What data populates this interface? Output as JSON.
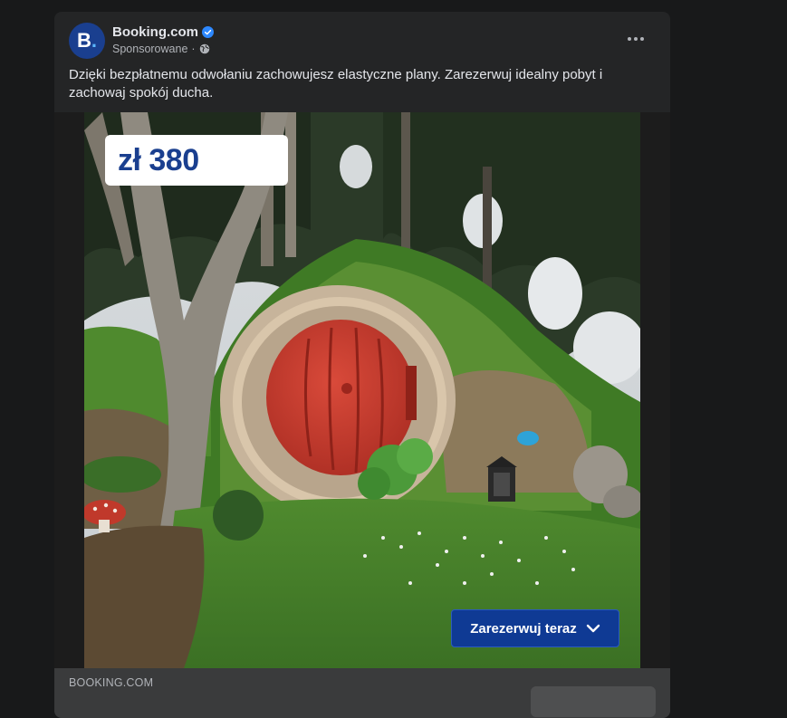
{
  "post": {
    "page_name": "Booking.com",
    "avatar_letter": "B",
    "avatar_dot": ".",
    "sponsored": "Sponsorowane",
    "separator": "·",
    "text": "Dzięki bezpłatnemu odwołaniu zachowujesz elastyczne plany. Zarezerwuj idealny pobyt i zachowaj spokój ducha.",
    "verified_icon": "verified-badge-icon",
    "privacy_icon": "globe-icon",
    "more_icon": "more-options-icon"
  },
  "ad": {
    "price": "zł 380",
    "cta_label": "Zarezerwuj teraz",
    "cta_icon": "chevron-down-icon"
  },
  "footer": {
    "domain": "BOOKING.COM"
  },
  "colors": {
    "brand": "#1a3f8f",
    "door": "#c0392b",
    "cta": "#0f3a94"
  }
}
